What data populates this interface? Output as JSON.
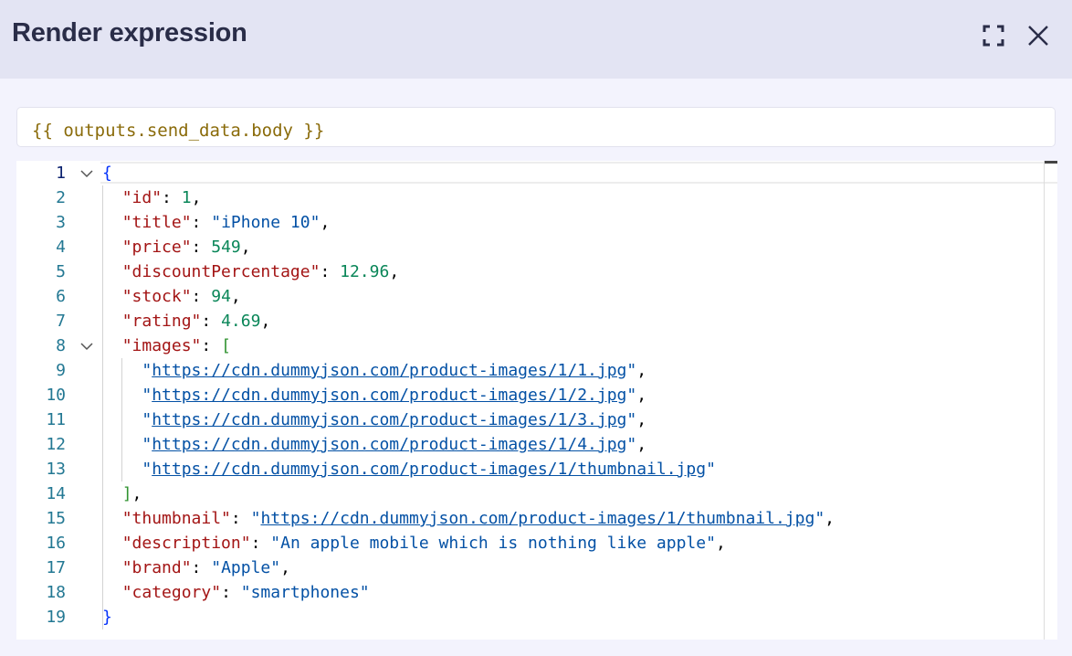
{
  "dialog": {
    "title": "Render expression",
    "expand_icon": "fullscreen-icon",
    "close_icon": "close-icon"
  },
  "expression": {
    "value": "{{ outputs.send_data.body }}"
  },
  "editor": {
    "lines": [
      {
        "number": "1",
        "tokens": [
          {
            "t": "{",
            "c": "b1"
          }
        ],
        "fold": true
      },
      {
        "number": "2",
        "tokens": [
          {
            "t": "  ",
            "c": "p"
          },
          {
            "t": "\"id\"",
            "c": "k"
          },
          {
            "t": ": ",
            "c": "p"
          },
          {
            "t": "1",
            "c": "n"
          },
          {
            "t": ",",
            "c": "p"
          }
        ]
      },
      {
        "number": "3",
        "tokens": [
          {
            "t": "  ",
            "c": "p"
          },
          {
            "t": "\"title\"",
            "c": "k"
          },
          {
            "t": ": ",
            "c": "p"
          },
          {
            "t": "\"iPhone 10\"",
            "c": "s"
          },
          {
            "t": ",",
            "c": "p"
          }
        ]
      },
      {
        "number": "4",
        "tokens": [
          {
            "t": "  ",
            "c": "p"
          },
          {
            "t": "\"price\"",
            "c": "k"
          },
          {
            "t": ": ",
            "c": "p"
          },
          {
            "t": "549",
            "c": "n"
          },
          {
            "t": ",",
            "c": "p"
          }
        ]
      },
      {
        "number": "5",
        "tokens": [
          {
            "t": "  ",
            "c": "p"
          },
          {
            "t": "\"discountPercentage\"",
            "c": "k"
          },
          {
            "t": ": ",
            "c": "p"
          },
          {
            "t": "12.96",
            "c": "n"
          },
          {
            "t": ",",
            "c": "p"
          }
        ]
      },
      {
        "number": "6",
        "tokens": [
          {
            "t": "  ",
            "c": "p"
          },
          {
            "t": "\"stock\"",
            "c": "k"
          },
          {
            "t": ": ",
            "c": "p"
          },
          {
            "t": "94",
            "c": "n"
          },
          {
            "t": ",",
            "c": "p"
          }
        ]
      },
      {
        "number": "7",
        "tokens": [
          {
            "t": "  ",
            "c": "p"
          },
          {
            "t": "\"rating\"",
            "c": "k"
          },
          {
            "t": ": ",
            "c": "p"
          },
          {
            "t": "4.69",
            "c": "n"
          },
          {
            "t": ",",
            "c": "p"
          }
        ]
      },
      {
        "number": "8",
        "tokens": [
          {
            "t": "  ",
            "c": "p"
          },
          {
            "t": "\"images\"",
            "c": "k"
          },
          {
            "t": ": ",
            "c": "p"
          },
          {
            "t": "[",
            "c": "b2"
          }
        ],
        "fold": true
      },
      {
        "number": "9",
        "tokens": [
          {
            "t": "    ",
            "c": "p"
          },
          {
            "t": "\"",
            "c": "s"
          },
          {
            "t": "https://cdn.dummyjson.com/product-images/1/1.jpg",
            "c": "s u"
          },
          {
            "t": "\"",
            "c": "s"
          },
          {
            "t": ",",
            "c": "p"
          }
        ]
      },
      {
        "number": "10",
        "tokens": [
          {
            "t": "    ",
            "c": "p"
          },
          {
            "t": "\"",
            "c": "s"
          },
          {
            "t": "https://cdn.dummyjson.com/product-images/1/2.jpg",
            "c": "s u"
          },
          {
            "t": "\"",
            "c": "s"
          },
          {
            "t": ",",
            "c": "p"
          }
        ]
      },
      {
        "number": "11",
        "tokens": [
          {
            "t": "    ",
            "c": "p"
          },
          {
            "t": "\"",
            "c": "s"
          },
          {
            "t": "https://cdn.dummyjson.com/product-images/1/3.jpg",
            "c": "s u"
          },
          {
            "t": "\"",
            "c": "s"
          },
          {
            "t": ",",
            "c": "p"
          }
        ]
      },
      {
        "number": "12",
        "tokens": [
          {
            "t": "    ",
            "c": "p"
          },
          {
            "t": "\"",
            "c": "s"
          },
          {
            "t": "https://cdn.dummyjson.com/product-images/1/4.jpg",
            "c": "s u"
          },
          {
            "t": "\"",
            "c": "s"
          },
          {
            "t": ",",
            "c": "p"
          }
        ]
      },
      {
        "number": "13",
        "tokens": [
          {
            "t": "    ",
            "c": "p"
          },
          {
            "t": "\"",
            "c": "s"
          },
          {
            "t": "https://cdn.dummyjson.com/product-images/1/thumbnail.jpg",
            "c": "s u"
          },
          {
            "t": "\"",
            "c": "s"
          }
        ]
      },
      {
        "number": "14",
        "tokens": [
          {
            "t": "  ",
            "c": "p"
          },
          {
            "t": "]",
            "c": "b2"
          },
          {
            "t": ",",
            "c": "p"
          }
        ]
      },
      {
        "number": "15",
        "tokens": [
          {
            "t": "  ",
            "c": "p"
          },
          {
            "t": "\"thumbnail\"",
            "c": "k"
          },
          {
            "t": ": ",
            "c": "p"
          },
          {
            "t": "\"",
            "c": "s"
          },
          {
            "t": "https://cdn.dummyjson.com/product-images/1/thumbnail.jpg",
            "c": "s u"
          },
          {
            "t": "\"",
            "c": "s"
          },
          {
            "t": ",",
            "c": "p"
          }
        ]
      },
      {
        "number": "16",
        "tokens": [
          {
            "t": "  ",
            "c": "p"
          },
          {
            "t": "\"description\"",
            "c": "k"
          },
          {
            "t": ": ",
            "c": "p"
          },
          {
            "t": "\"An apple mobile which is nothing like apple\"",
            "c": "s"
          },
          {
            "t": ",",
            "c": "p"
          }
        ]
      },
      {
        "number": "17",
        "tokens": [
          {
            "t": "  ",
            "c": "p"
          },
          {
            "t": "\"brand\"",
            "c": "k"
          },
          {
            "t": ": ",
            "c": "p"
          },
          {
            "t": "\"Apple\"",
            "c": "s"
          },
          {
            "t": ",",
            "c": "p"
          }
        ]
      },
      {
        "number": "18",
        "tokens": [
          {
            "t": "  ",
            "c": "p"
          },
          {
            "t": "\"category\"",
            "c": "k"
          },
          {
            "t": ": ",
            "c": "p"
          },
          {
            "t": "\"smartphones\"",
            "c": "s"
          }
        ]
      },
      {
        "number": "19",
        "tokens": [
          {
            "t": "}",
            "c": "b1"
          }
        ]
      }
    ]
  }
}
